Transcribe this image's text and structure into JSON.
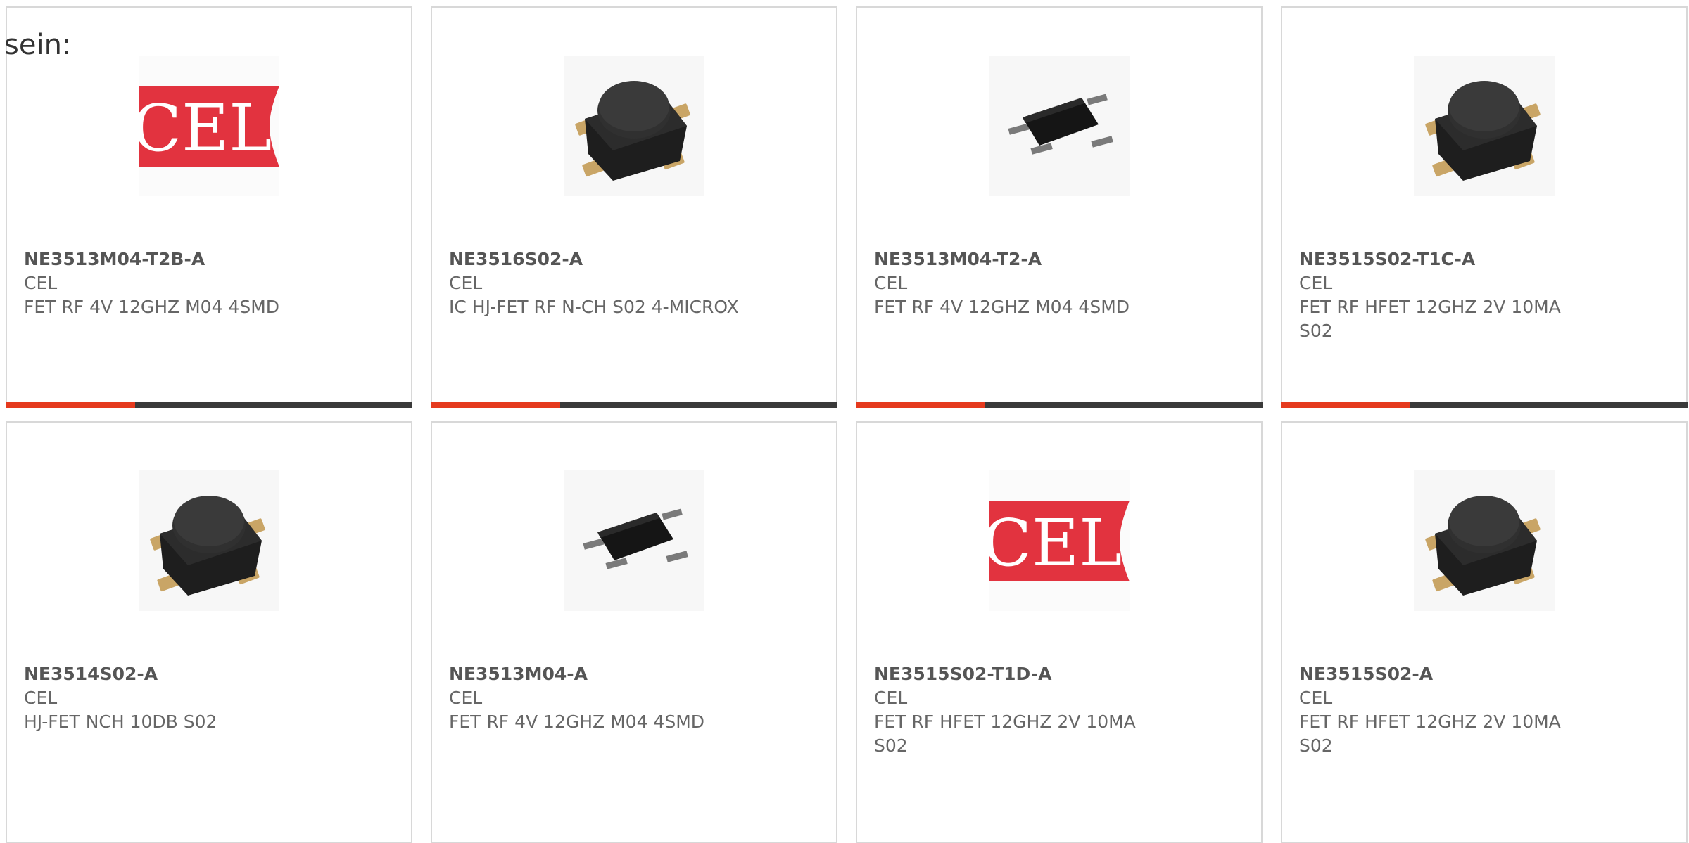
{
  "intro_text": "sein:",
  "colors": {
    "accent": "#e53a1e",
    "bar_base": "#3a3a3a",
    "border": "#d8d8d8",
    "text": "#666666",
    "logo_red": "#e2333f"
  },
  "products": [
    {
      "part_number": "NE3513M04-T2B-A",
      "manufacturer": "CEL",
      "description": "FET RF 4V 12GHZ M04 4SMD",
      "image": "cel-logo",
      "logo_text": "CEL"
    },
    {
      "part_number": "NE3516S02-A",
      "manufacturer": "CEL",
      "description": "IC HJ-FET RF N-CH S02 4-MICROX",
      "image": "s02-package-photo"
    },
    {
      "part_number": "NE3513M04-T2-A",
      "manufacturer": "CEL",
      "description": "FET RF 4V 12GHZ M04 4SMD",
      "image": "m04-package-photo"
    },
    {
      "part_number": "NE3515S02-T1C-A",
      "manufacturer": "CEL",
      "description": "FET RF HFET 12GHZ 2V 10MA S02",
      "image": "s02-package-photo"
    },
    {
      "part_number": "NE3514S02-A",
      "manufacturer": "CEL",
      "description": "HJ-FET NCH 10DB S02",
      "image": "s02-package-photo"
    },
    {
      "part_number": "NE3513M04-A",
      "manufacturer": "CEL",
      "description": "FET RF 4V 12GHZ M04 4SMD",
      "image": "m04-package-photo"
    },
    {
      "part_number": "NE3515S02-T1D-A",
      "manufacturer": "CEL",
      "description": "FET RF HFET 12GHZ 2V 10MA S02",
      "image": "cel-logo",
      "logo_text": "CEL"
    },
    {
      "part_number": "NE3515S02-A",
      "manufacturer": "CEL",
      "description": "FET RF HFET 12GHZ 2V 10MA S02",
      "image": "s02-package-photo"
    }
  ]
}
